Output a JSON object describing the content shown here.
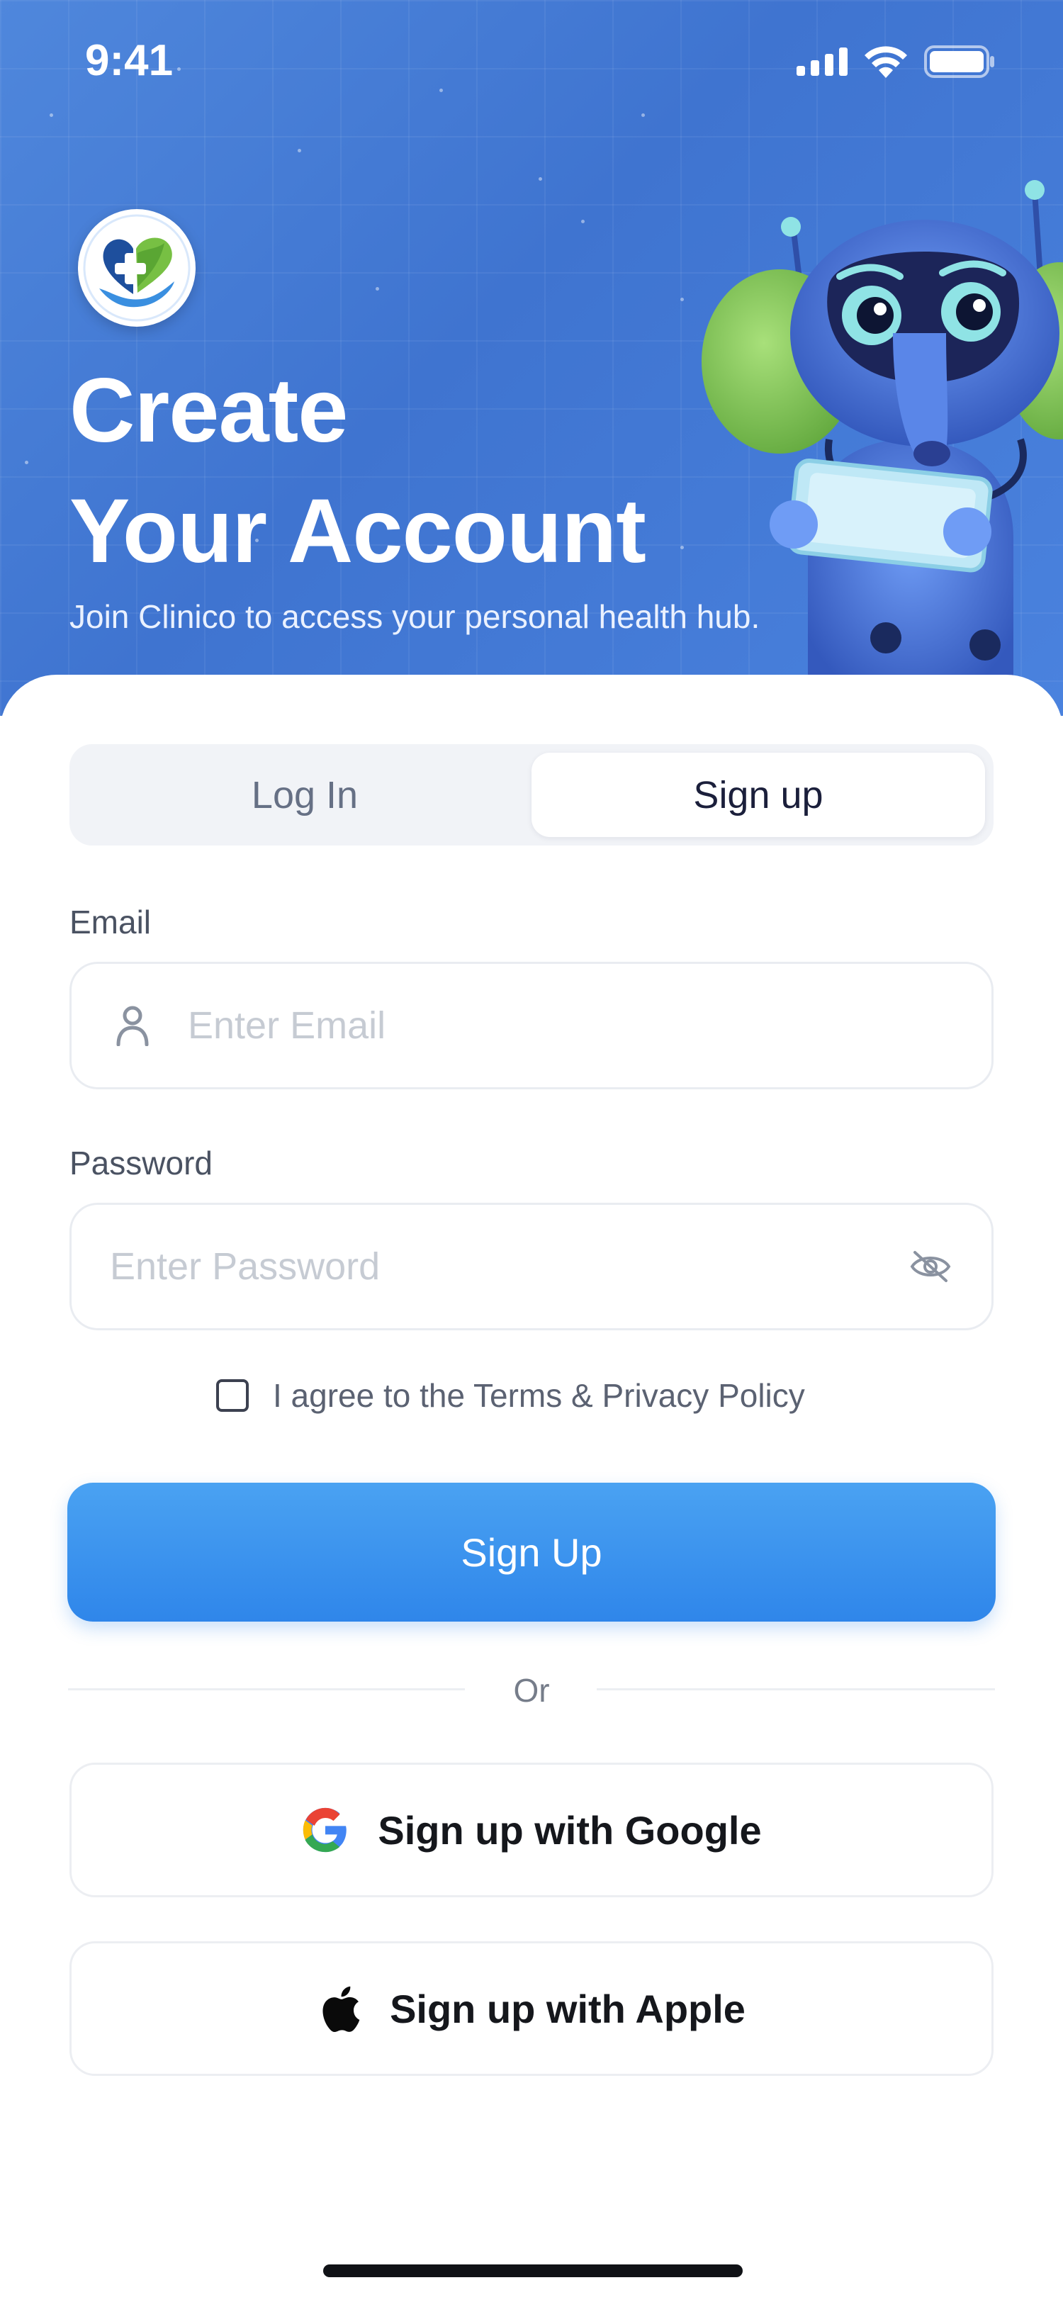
{
  "status_bar": {
    "time": "9:41"
  },
  "hero": {
    "title_line1": "Create",
    "title_line2": "Your Account",
    "subtitle": "Join Clinico to access your personal health hub."
  },
  "tabs": {
    "login_label": "Log In",
    "signup_label": "Sign up",
    "active": "Sign up"
  },
  "form": {
    "email_label": "Email",
    "email_placeholder": "Enter Email",
    "email_value": "",
    "password_label": "Password",
    "password_placeholder": "Enter Password",
    "password_value": "",
    "agree_text": "I agree to the Terms & Privacy Policy",
    "agree_checked": false,
    "submit_label": "Sign Up"
  },
  "divider": {
    "text": "Or"
  },
  "social": {
    "google_label": "Sign up with Google",
    "apple_label": "Sign up with Apple"
  },
  "colors": {
    "hero_blue": "#4a7fda",
    "primary_button": "#3a8fee",
    "text_dark": "#1b1f3b",
    "text_muted": "#667085",
    "placeholder": "#c6cbd3",
    "google_blue": "#4285F4",
    "google_red": "#EA4335",
    "google_yellow": "#FBBC05",
    "google_green": "#34A853"
  },
  "icons": {
    "email_field": "user-icon",
    "password_toggle": "eye-off-icon",
    "google": "google-logo-icon",
    "apple": "apple-logo-icon",
    "logo": "clinico-heart-hand-logo"
  }
}
